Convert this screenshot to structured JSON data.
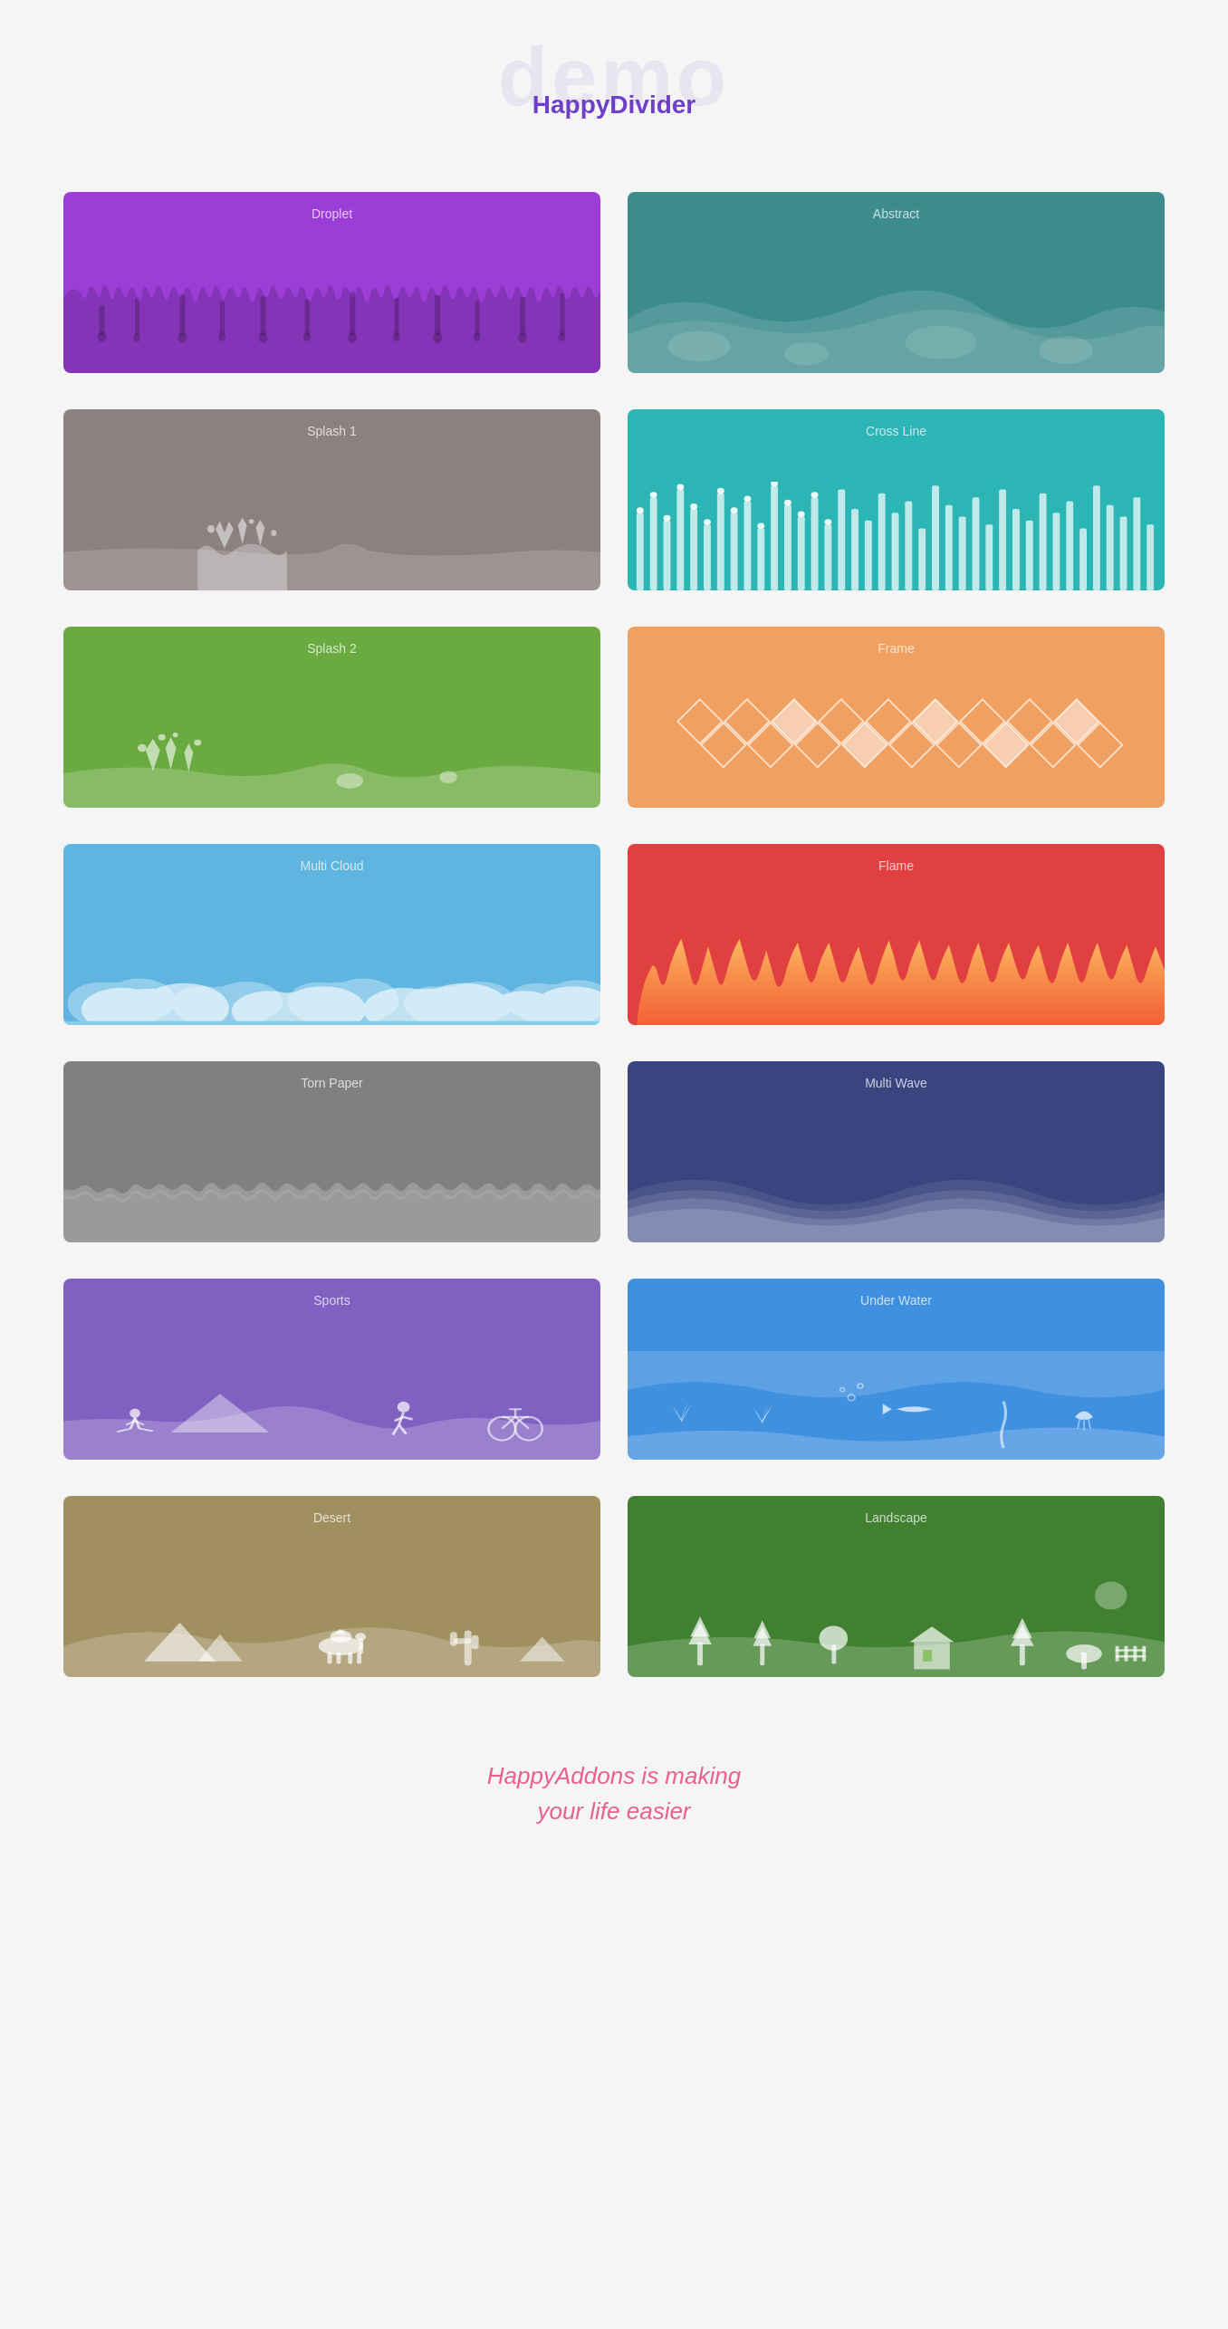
{
  "header": {
    "demo_text": "demo",
    "happy_text": "Happy",
    "divider_text": "Divider"
  },
  "cards": [
    {
      "id": "droplet",
      "label": "Droplet",
      "color": "#9b3dd6"
    },
    {
      "id": "abstract",
      "label": "Abstract",
      "color": "#3d8c8c"
    },
    {
      "id": "splash1",
      "label": "Splash 1",
      "color": "#8c8080"
    },
    {
      "id": "crossline",
      "label": "Cross Line",
      "color": "#2cb5b5"
    },
    {
      "id": "splash2",
      "label": "Splash 2",
      "color": "#6aaa40"
    },
    {
      "id": "frame",
      "label": "Frame",
      "color": "#f0a060"
    },
    {
      "id": "multicloud",
      "label": "Multi Cloud",
      "color": "#60b5e0"
    },
    {
      "id": "flame",
      "label": "Flame",
      "color": "#e04040"
    },
    {
      "id": "tornpaper",
      "label": "Torn Paper",
      "color": "#808080"
    },
    {
      "id": "multiwave",
      "label": "Multi Wave",
      "color": "#3a4580"
    },
    {
      "id": "sports",
      "label": "Sports",
      "color": "#8060c0"
    },
    {
      "id": "underwater",
      "label": "Under Water",
      "color": "#4090e0"
    },
    {
      "id": "desert",
      "label": "Desert",
      "color": "#a09060"
    },
    {
      "id": "landscape",
      "label": "Landscape",
      "color": "#408030"
    }
  ],
  "footer": {
    "line1": "HappyAddons is making",
    "line2": "your life easier"
  }
}
